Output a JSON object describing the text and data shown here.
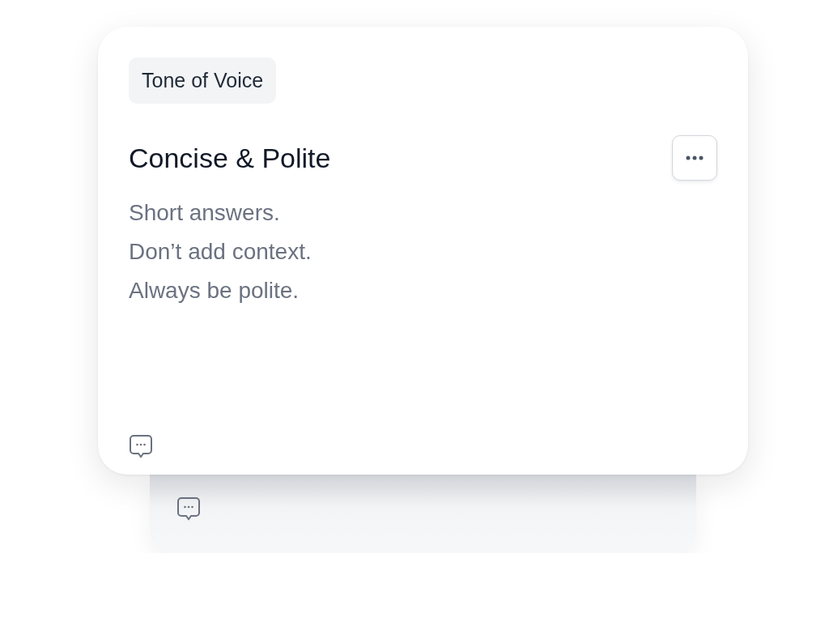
{
  "card": {
    "tag": "Tone of Voice",
    "title": "Concise & Polite",
    "lines": [
      "Short answers.",
      "Don’t add context.",
      "Always be polite."
    ]
  }
}
